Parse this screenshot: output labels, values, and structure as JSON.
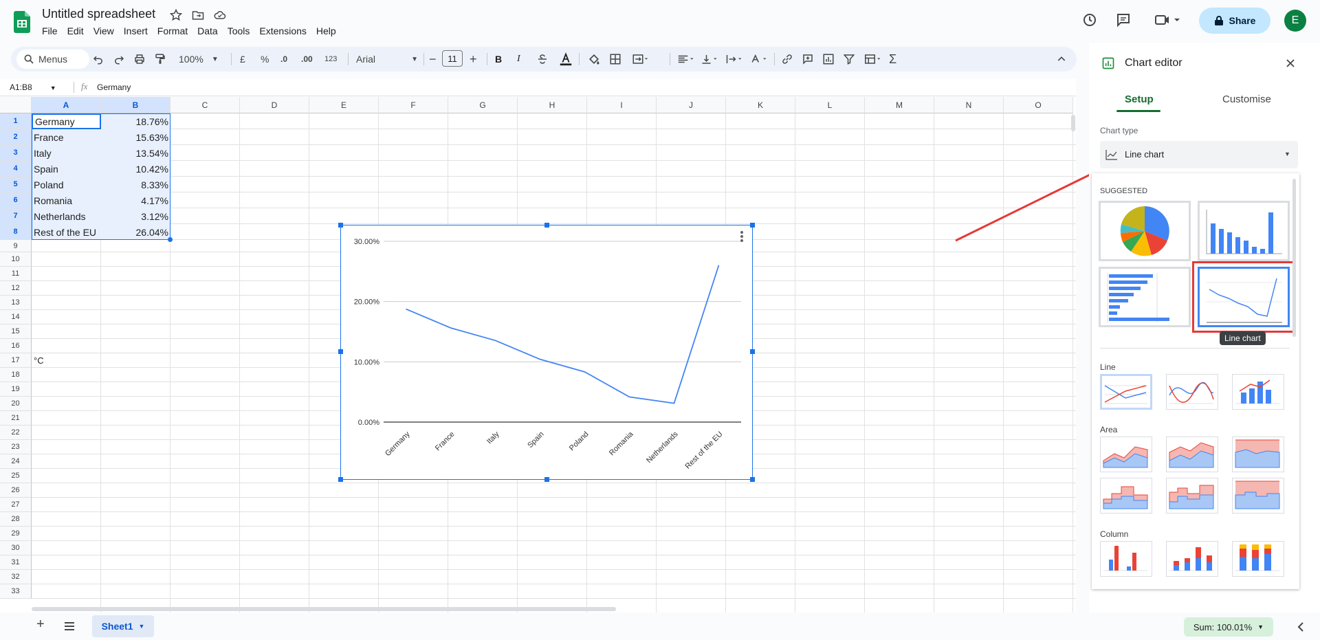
{
  "app": {
    "title": "Untitled spreadsheet",
    "menu": [
      "File",
      "Edit",
      "View",
      "Insert",
      "Format",
      "Data",
      "Tools",
      "Extensions",
      "Help"
    ],
    "share_label": "Share",
    "avatar_letter": "E"
  },
  "toolbar": {
    "menus_label": "Menus",
    "zoom": "100%",
    "currency": "£",
    "percent": "%",
    "decrease_decimal": ".0",
    "increase_decimal": ".00",
    "number_format": "123",
    "font": "Arial",
    "font_size": "11",
    "bold": "B",
    "italic": "I"
  },
  "formula_bar": {
    "name_box": "A1:B8",
    "fx": "fx",
    "content": "Germany"
  },
  "columns": [
    "A",
    "B",
    "C",
    "D",
    "E",
    "F",
    "G",
    "H",
    "I",
    "J",
    "K",
    "L",
    "M",
    "N",
    "O"
  ],
  "rows": [
    "1",
    "2",
    "3",
    "4",
    "5",
    "6",
    "7",
    "8",
    "9",
    "10",
    "11",
    "12",
    "13",
    "14",
    "15",
    "16",
    "17",
    "18",
    "19",
    "20",
    "21",
    "22",
    "23",
    "24",
    "25",
    "26",
    "27",
    "28",
    "29",
    "30",
    "31",
    "32",
    "33"
  ],
  "cells": {
    "a": [
      "Germany",
      "France",
      "Italy",
      "Spain",
      "Poland",
      "Romania",
      "Netherlands",
      "Rest of the EU"
    ],
    "b": [
      "18.76%",
      "15.63%",
      "13.54%",
      "10.42%",
      "8.33%",
      "4.17%",
      "3.12%",
      "26.04%"
    ],
    "a17": "°C"
  },
  "chart_data": {
    "type": "line",
    "categories": [
      "Germany",
      "France",
      "Italy",
      "Spain",
      "Poland",
      "Romania",
      "Netherlands",
      "Rest of the EU"
    ],
    "values": [
      18.76,
      15.63,
      13.54,
      10.42,
      8.33,
      4.17,
      3.12,
      26.04
    ],
    "ylim": [
      0,
      30
    ],
    "yticks": [
      "0.00%",
      "10.00%",
      "20.00%",
      "30.00%"
    ],
    "grid": true,
    "color": "#4285f4"
  },
  "panel": {
    "title": "Chart editor",
    "tab_setup": "Setup",
    "tab_customise": "Customise",
    "chart_type_label": "Chart type",
    "chart_type_value": "Line chart",
    "suggested": "SUGGESTED",
    "tooltip": "Line chart",
    "section_line": "Line",
    "section_area": "Area",
    "section_column": "Column"
  },
  "bottom": {
    "sheet_name": "Sheet1",
    "sum": "Sum: 100.01%"
  },
  "colors": {
    "accent": "#1a73e8",
    "annotation_red": "#e53935",
    "share_bg": "#c2e7ff",
    "sum_bg": "#d7f0dc"
  }
}
